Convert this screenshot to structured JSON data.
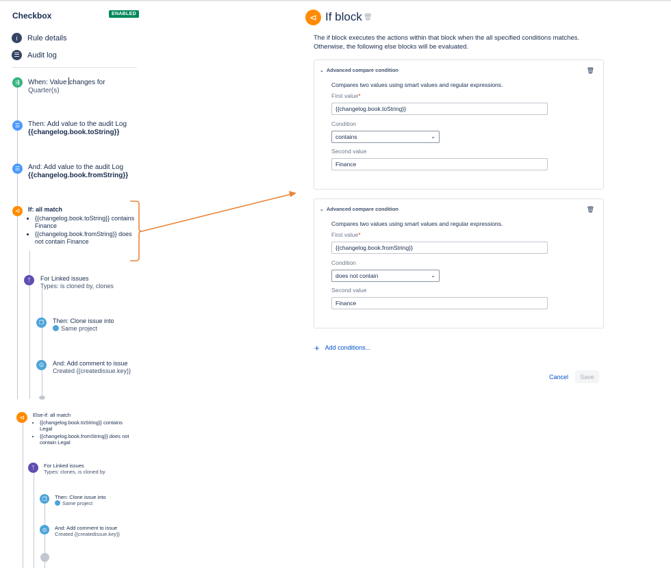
{
  "rule": {
    "title": "Checkbox",
    "status": "ENABLED"
  },
  "nav": [
    {
      "label": "Rule details",
      "icon": "info-icon"
    },
    {
      "label": "Audit log",
      "icon": "audit-log-icon"
    }
  ],
  "components": {
    "trigger": {
      "title_pre": "When: Value ",
      "title_post": "changes for",
      "sub": "Quarter(s)"
    },
    "log1": {
      "title": "Then: Add value to the audit Log",
      "sub": "{{changelog.book.toString}}"
    },
    "log2": {
      "title": "And: Add value to the audit Log",
      "sub": "{{changelog.book.fromString}}"
    },
    "if1": {
      "title": "If: all match",
      "conds": [
        "{{changelog.book.toString}} contains Finance",
        "{{changelog.book.fromString}} does not contain Finance"
      ]
    },
    "linked1": {
      "title": "For Linked issues",
      "sub": "Types: is cloned by, clones"
    },
    "clone1": {
      "title": "Then: Clone issue into",
      "sub": "Same project"
    },
    "comment1": {
      "title": "And: Add comment to issue",
      "sub": "Created {{createdissue.key}}"
    },
    "elseif": {
      "title": "Else-if: all match",
      "conds": [
        "{{changelog.book.toString}} contains Legal",
        "{{changelog.book.fromString}} does not contain Legal"
      ]
    },
    "linked2": {
      "title": "For Linked issues",
      "sub": "Types: clones, is cloned by"
    },
    "clone2": {
      "title": "Then: Clone issue into",
      "sub": "Same project"
    },
    "comment2": {
      "title": "And: Add comment to issue",
      "sub": "Created {{createdissue.key}}"
    }
  },
  "panel": {
    "title": "If block",
    "description": "The if block executes the actions within that block when the all specified conditions matches. Otherwise, the following else blocks will be evaluated.",
    "conditions": [
      {
        "header": "Advanced compare condition",
        "description": "Compares two values using smart values and regular expressions.",
        "first_label": "First value",
        "first_value": "{{changelog.book.toString}}",
        "condition_label": "Condition",
        "condition_value": "contains",
        "second_label": "Second value",
        "second_value": "Finance"
      },
      {
        "header": "Advanced compare condition",
        "description": "Compares two values using smart values and regular expressions.",
        "first_label": "First value",
        "first_value": "{{changelog.book.fromString}}",
        "condition_label": "Condition",
        "condition_value": "does not contain",
        "second_label": "Second value",
        "second_value": "Finance"
      }
    ],
    "add_conditions": "Add conditions...",
    "cancel": "Cancel",
    "save": "Save",
    "required_mark": "*"
  },
  "colors": {
    "accent": "#0052cc",
    "if_orange": "#ff8b00",
    "enabled_green": "#00875a",
    "annotation": "#e8843a"
  }
}
